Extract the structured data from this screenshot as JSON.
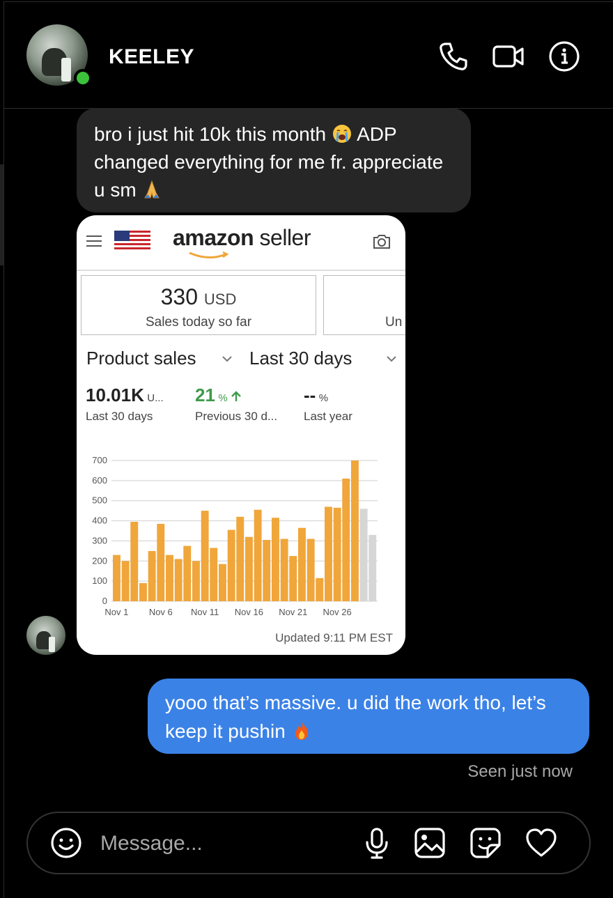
{
  "header": {
    "name": "KEELEY"
  },
  "messages": {
    "incoming_text_1": "bro i just hit 10k this month",
    "incoming_text_2": "ADP changed everything for me fr. appreciate u sm",
    "outgoing_text": "yooo that’s massive. u did the work tho, let’s keep it pushin",
    "seen": "Seen just now"
  },
  "card": {
    "brand_a": "amazon",
    "brand_b": "seller",
    "sales_today_value": "330",
    "sales_today_unit": "USD",
    "sales_today_label": "Sales today so far",
    "tile2_label": "Un",
    "dropdown_metric": "Product sales",
    "dropdown_range": "Last 30 days",
    "metrics": [
      {
        "value": "10.01K",
        "unit": "U...",
        "label": "Last 30 days"
      },
      {
        "value": "21",
        "unit": "%",
        "label": "Previous 30 d..."
      },
      {
        "value": "--",
        "unit": "%",
        "label": "Last year"
      }
    ],
    "updated": "Updated 9:11 PM EST"
  },
  "chart_data": {
    "type": "bar",
    "ylim": [
      0,
      700
    ],
    "yticks": [
      0,
      100,
      200,
      300,
      400,
      500,
      600,
      700
    ],
    "tick_labels": [
      "Nov 1",
      "Nov 6",
      "Nov 11",
      "Nov 16",
      "Nov 21",
      "Nov 26"
    ],
    "values": [
      230,
      200,
      395,
      90,
      250,
      385,
      230,
      210,
      275,
      200,
      450,
      265,
      185,
      355,
      420,
      320,
      455,
      305,
      415,
      310,
      225,
      365,
      310,
      115,
      470,
      465,
      610,
      700,
      460,
      330
    ],
    "projected_from_index": 28,
    "colors": {
      "actual": "#f0a63a",
      "projected": "#d6d6d6",
      "grid": "#cfcfcf"
    }
  },
  "composer": {
    "placeholder": "Message..."
  }
}
